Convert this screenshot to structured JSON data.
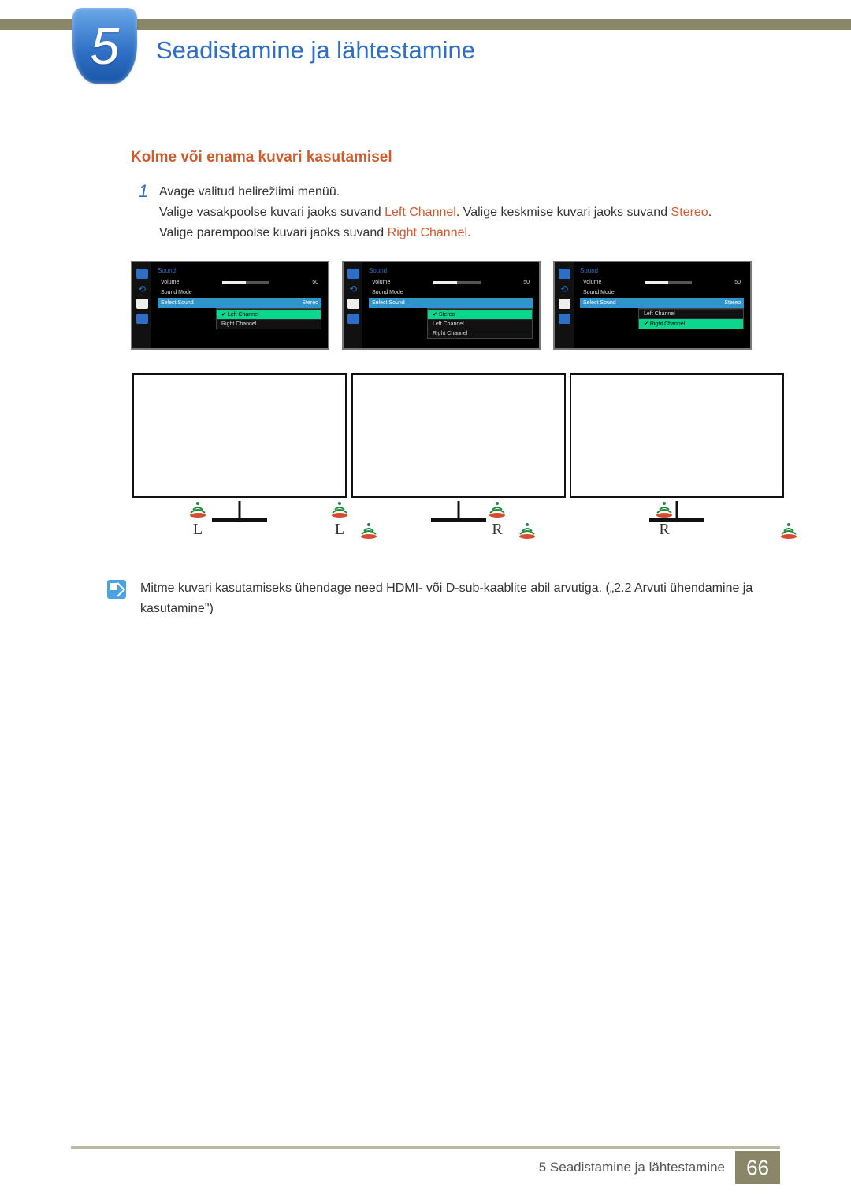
{
  "chapter": {
    "number": "5",
    "title": "Seadistamine ja lähtestamine"
  },
  "section": {
    "heading": "Kolme või enama kuvari kasutamisel"
  },
  "step": {
    "num": "1",
    "line1": "Avage valitud helirežiimi menüü.",
    "line2_part1": "Valige vasakpoolse kuvari jaoks suvand ",
    "line2_hl1": "Left Channel",
    "line2_part2": ". Valige keskmise kuvari jaoks suvand ",
    "line2_hl2": "Stereo",
    "line2_part3": ".",
    "line3_part1": "Valige parempoolse kuvari jaoks suvand ",
    "line3_hl1": "Right Channel",
    "line3_part2": "."
  },
  "osd": {
    "title": "Sound",
    "volume_label": "Volume",
    "volume_value": "50",
    "sound_mode_label": "Sound Mode",
    "select_sound_label": "Select Sound",
    "options": {
      "stereo": "Stereo",
      "left": "Left Channel",
      "right": "Right Channel"
    }
  },
  "speakers": {
    "L": "L",
    "R": "R"
  },
  "note": {
    "text": "Mitme kuvari kasutamiseks ühendage need HDMI- või D-sub-kaablite abil arvutiga. („2.2 Arvuti ühendamine ja kasutamine\")"
  },
  "footer": {
    "text": "5 Seadistamine ja lähtestamine",
    "page": "66"
  }
}
